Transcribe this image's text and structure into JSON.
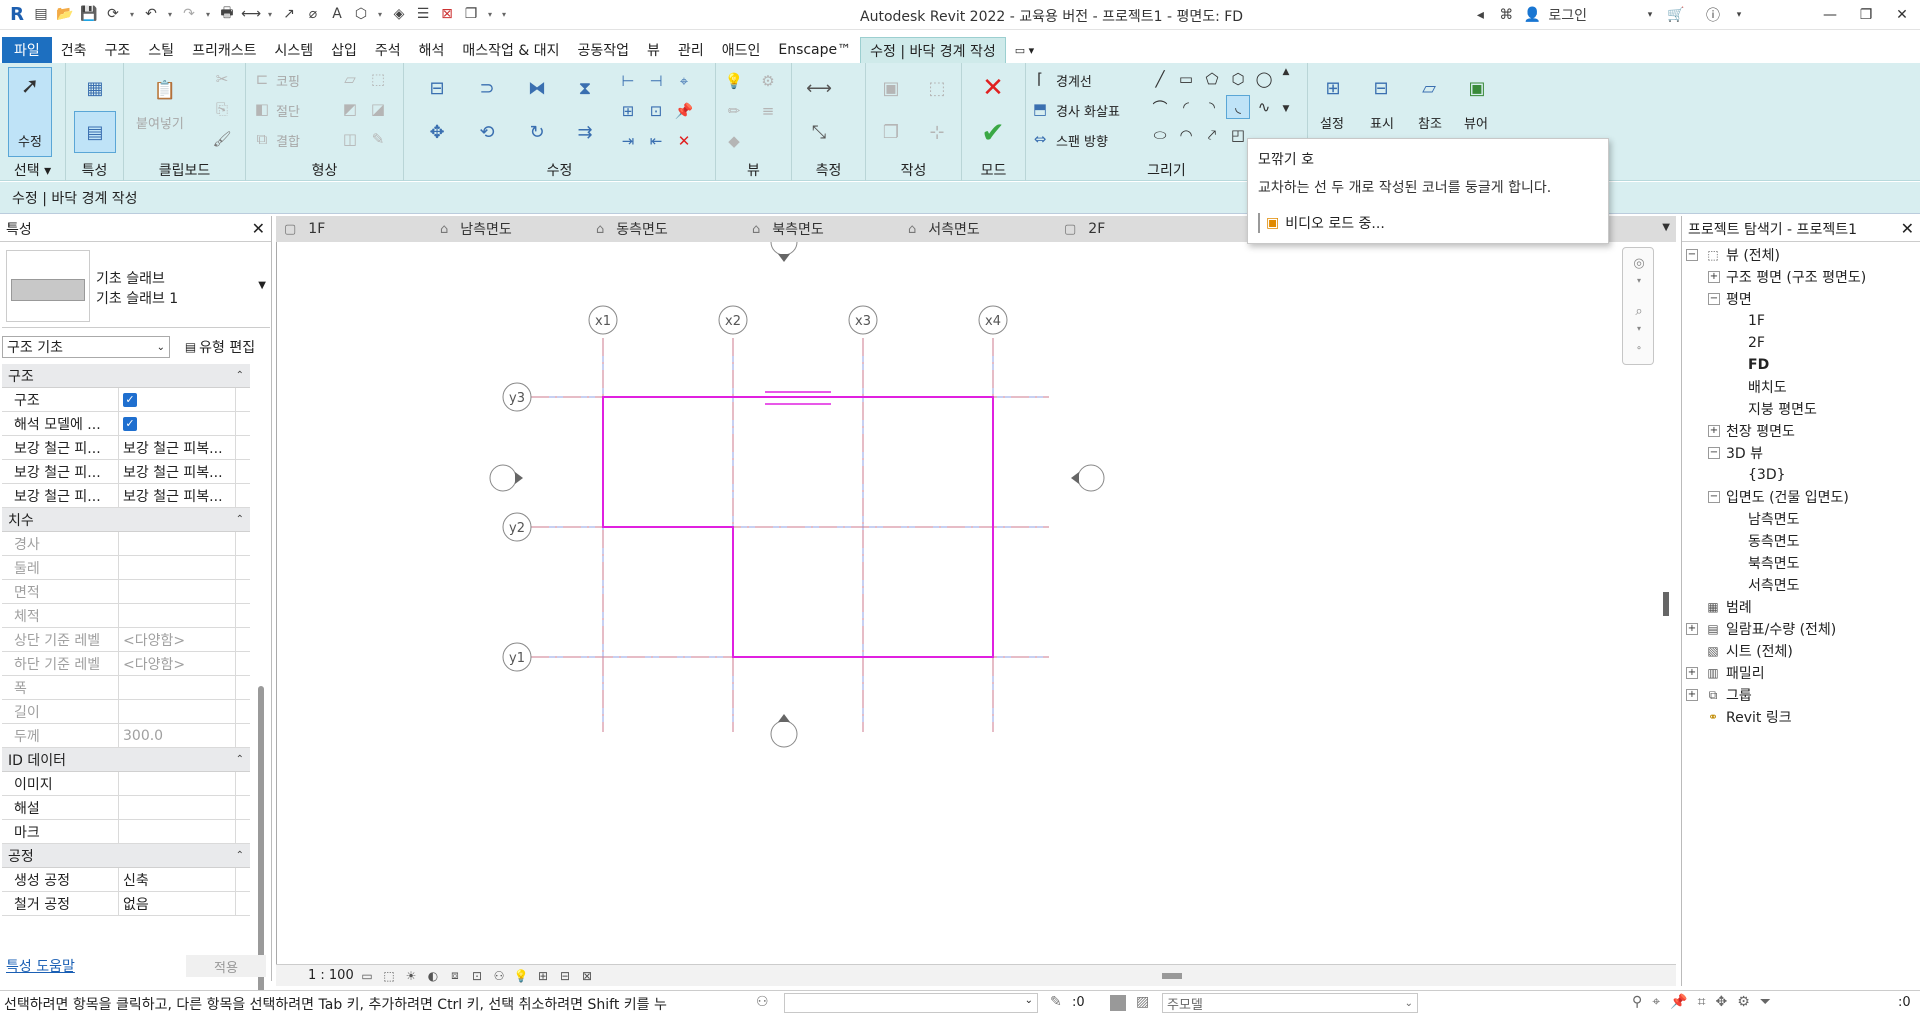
{
  "title_bar": {
    "title": "Autodesk Revit 2022 - 교육용 버전 - 프로젝트1 - 평면도: FD",
    "login": "로그인",
    "help_icon": "question-icon"
  },
  "tabs": [
    "파일",
    "건축",
    "구조",
    "스틸",
    "프리캐스트",
    "시스템",
    "삽입",
    "주석",
    "해석",
    "매스작업 & 대지",
    "공동작업",
    "뷰",
    "관리",
    "애드인",
    "Enscape™",
    "수정 | 바닥 경계 작성"
  ],
  "ribbon": {
    "select": {
      "button": "수정",
      "label": "선택"
    },
    "properties": {
      "label": "특성"
    },
    "clipboard": {
      "paste": "붙여넣기",
      "label": "클립보드"
    },
    "geometry": {
      "cope": "코핑",
      "cut": "절단",
      "join": "결합",
      "label": "형상"
    },
    "modify": {
      "label": "수정"
    },
    "view": {
      "label": "뷰"
    },
    "measure": {
      "label": "측정"
    },
    "create": {
      "label": "작성"
    },
    "mode": {
      "label": "모드"
    },
    "draw": {
      "boundary_line": "경계선",
      "slope_arrow": "경사 화살표",
      "span_direction": "스팬 방향",
      "label": "그리기"
    },
    "workplane": {
      "set": "설정",
      "show": "표시",
      "ref_plane": "참조",
      "viewer": "뷰어"
    }
  },
  "options_bar": {
    "text": "수정 | 바닥 경계 작성"
  },
  "properties": {
    "header": "특성",
    "type_family": "기초 슬래브",
    "type_name": "기초 슬래브 1",
    "filter": "구조 기초",
    "edit_type": "유형 편집",
    "groups": [
      {
        "name": "구조",
        "rows": [
          {
            "k": "구조",
            "v": "",
            "check": true
          },
          {
            "k": "해석 모델에 ...",
            "v": "",
            "check": true
          },
          {
            "k": "보강 철근 피...",
            "v": "보강 철근 피복..."
          },
          {
            "k": "보강 철근 피...",
            "v": "보강 철근 피복..."
          },
          {
            "k": "보강 철근 피...",
            "v": "보강 철근 피복..."
          }
        ]
      },
      {
        "name": "치수",
        "rows": [
          {
            "k": "경사",
            "v": "",
            "dis": true
          },
          {
            "k": "둘레",
            "v": "",
            "dis": true
          },
          {
            "k": "면적",
            "v": "",
            "dis": true
          },
          {
            "k": "체적",
            "v": "",
            "dis": true
          },
          {
            "k": "상단 기준 레벨",
            "v": "<다양함>",
            "dis": true
          },
          {
            "k": "하단 기준 레벨",
            "v": "<다양함>",
            "dis": true
          },
          {
            "k": "폭",
            "v": "",
            "dis": true
          },
          {
            "k": "길이",
            "v": "",
            "dis": true
          },
          {
            "k": "두께",
            "v": "300.0",
            "dis": true
          }
        ]
      },
      {
        "name": "ID 데이터",
        "rows": [
          {
            "k": "이미지",
            "v": ""
          },
          {
            "k": "해설",
            "v": ""
          },
          {
            "k": "마크",
            "v": ""
          }
        ]
      },
      {
        "name": "공정",
        "rows": [
          {
            "k": "생성 공정",
            "v": "신축"
          },
          {
            "k": "철거 공정",
            "v": "없음"
          }
        ]
      }
    ],
    "help_link": "특성 도움말",
    "apply": "적용"
  },
  "view_tabs": [
    "1F",
    "남측면도",
    "동측면도",
    "북측면도",
    "서측면도",
    "2F"
  ],
  "drawing": {
    "grid_x": [
      "x1",
      "x2",
      "x3",
      "x4"
    ],
    "grid_y": [
      "y3",
      "y2",
      "y1"
    ],
    "boundary_color": "#e020e0",
    "grid_color": "#8fa0e6",
    "grid_red_color": "#e86a6a"
  },
  "view_control": {
    "scale": "1 : 100"
  },
  "browser": {
    "header": "프로젝트 탐색기 - 프로젝트1",
    "items": [
      {
        "label": "뷰 (전체)",
        "depth": 0,
        "tg": "-",
        "icon": "view-icon"
      },
      {
        "label": "구조 평면 (구조 평면도)",
        "depth": 1,
        "tg": "+"
      },
      {
        "label": "평면",
        "depth": 1,
        "tg": "-"
      },
      {
        "label": "1F",
        "depth": 2,
        "tg": ""
      },
      {
        "label": "2F",
        "depth": 2,
        "tg": ""
      },
      {
        "label": "FD",
        "depth": 2,
        "tg": "",
        "bold": true
      },
      {
        "label": "배치도",
        "depth": 2,
        "tg": ""
      },
      {
        "label": "지붕 평면도",
        "depth": 2,
        "tg": ""
      },
      {
        "label": "천장 평면도",
        "depth": 1,
        "tg": "+"
      },
      {
        "label": "3D 뷰",
        "depth": 1,
        "tg": "-"
      },
      {
        "label": "{3D}",
        "depth": 2,
        "tg": ""
      },
      {
        "label": "입면도 (건물 입면도)",
        "depth": 1,
        "tg": "-"
      },
      {
        "label": "남측면도",
        "depth": 2,
        "tg": ""
      },
      {
        "label": "동측면도",
        "depth": 2,
        "tg": ""
      },
      {
        "label": "북측면도",
        "depth": 2,
        "tg": ""
      },
      {
        "label": "서측면도",
        "depth": 2,
        "tg": ""
      },
      {
        "label": "범례",
        "depth": 0,
        "tg": "",
        "icon": "legend-icon"
      },
      {
        "label": "일람표/수량 (전체)",
        "depth": 0,
        "tg": "+",
        "icon": "schedule-icon"
      },
      {
        "label": "시트 (전체)",
        "depth": 0,
        "tg": "",
        "icon": "sheet-icon"
      },
      {
        "label": "패밀리",
        "depth": 0,
        "tg": "+",
        "icon": "family-icon"
      },
      {
        "label": "그룹",
        "depth": 0,
        "tg": "+",
        "icon": "group-icon"
      },
      {
        "label": "Revit 링크",
        "depth": 0,
        "tg": "",
        "icon": "link-icon"
      }
    ]
  },
  "tooltip": {
    "title": "모깎기 호",
    "description": "교차하는 선 두 개로 작성된 코너를 둥글게 합니다.",
    "video": "비디오 로드 중..."
  },
  "status_bar": {
    "text": "선택하려면 항목을 클릭하고, 다른 항목을 선택하려면 Tab 키, 추가하려면 Ctrl 키, 선택 취소하려면 Shift 키를 누",
    "zero1": ":0",
    "model": "주모델",
    "zero2": ":0"
  }
}
